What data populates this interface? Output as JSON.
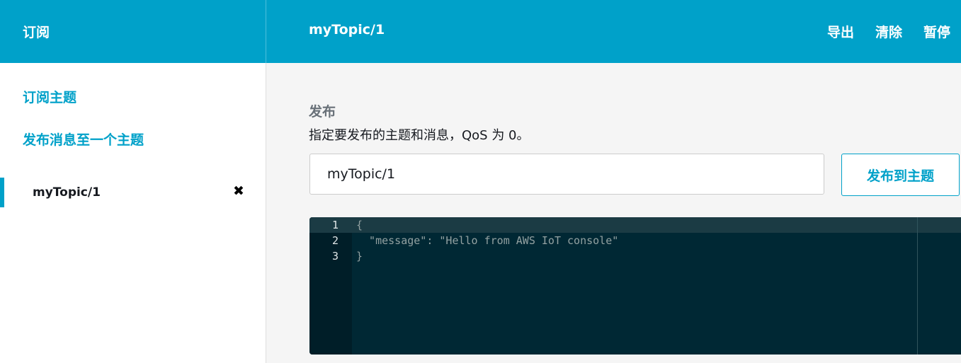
{
  "header": {
    "app_title": "订阅",
    "topic_title": "myTopic/1",
    "actions": {
      "export": "导出",
      "clear": "清除",
      "pause": "暂停"
    }
  },
  "sidebar": {
    "subscribe_link": "订阅主题",
    "publish_link": "发布消息至一个主题",
    "topics": [
      {
        "label": "myTopic/1",
        "close_icon": "✖"
      }
    ]
  },
  "publish": {
    "title": "发布",
    "description": "指定要发布的主题和消息，QoS 为 0。",
    "topic_value": "myTopic/1",
    "button_label": "发布到主题"
  },
  "editor": {
    "lines": [
      {
        "num": "1",
        "code": "{"
      },
      {
        "num": "2",
        "code": "  \"message\": \"Hello from AWS IoT console\""
      },
      {
        "num": "3",
        "code": "}"
      }
    ]
  },
  "colors": {
    "accent": "#00a1c9",
    "editor_bg": "#002834",
    "gutter_bg": "#001e28"
  }
}
